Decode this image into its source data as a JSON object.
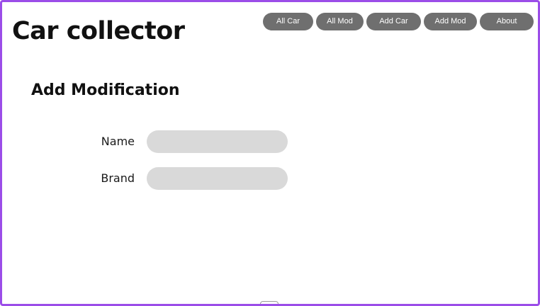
{
  "header": {
    "title": "Car collector"
  },
  "nav": {
    "items": [
      {
        "label": "All Car"
      },
      {
        "label": "All Mod"
      },
      {
        "label": "Add Car"
      },
      {
        "label": "Add Mod"
      },
      {
        "label": "About"
      }
    ]
  },
  "main": {
    "heading": "Add Modification",
    "form": {
      "name": {
        "label": "Name",
        "value": "",
        "placeholder": ""
      },
      "brand": {
        "label": "Brand",
        "value": "",
        "placeholder": ""
      }
    }
  },
  "colors": {
    "frame_border": "#9b4de8",
    "nav_button_bg": "#6f6f6f",
    "input_bg": "#d9d9d9"
  }
}
